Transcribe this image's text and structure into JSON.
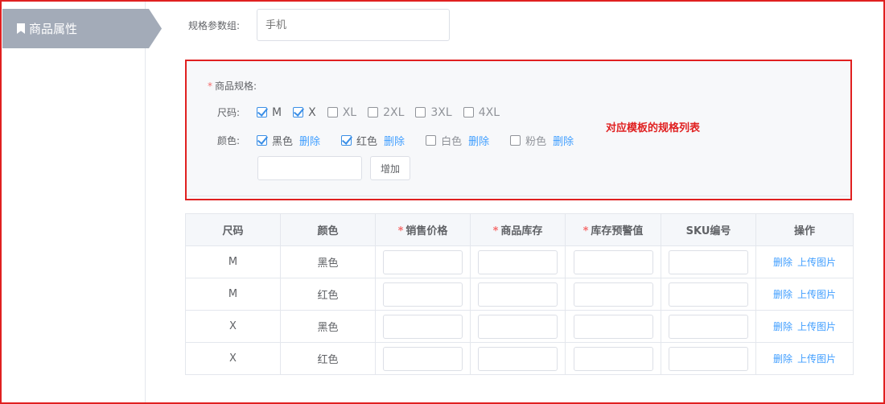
{
  "sidebar": {
    "tab_label": "商品属性",
    "tab_icon": "bookmark-icon"
  },
  "form": {
    "spec_group_label": "规格参数组:",
    "spec_group_placeholder": "手机",
    "spec_title": "商品规格:",
    "size_label": "尺码:",
    "color_label": "颜色:",
    "sizes": [
      {
        "label": "M",
        "checked": true
      },
      {
        "label": "X",
        "checked": true
      },
      {
        "label": "XL",
        "checked": false
      },
      {
        "label": "2XL",
        "checked": false
      },
      {
        "label": "3XL",
        "checked": false
      },
      {
        "label": "4XL",
        "checked": false
      }
    ],
    "colors": [
      {
        "label": "黑色",
        "checked": true,
        "delete": "删除"
      },
      {
        "label": "红色",
        "checked": true,
        "delete": "删除"
      },
      {
        "label": "白色",
        "checked": false,
        "delete": "删除"
      },
      {
        "label": "粉色",
        "checked": false,
        "delete": "删除"
      }
    ],
    "add_button": "增加",
    "add_input_value": ""
  },
  "annotation": "对应模板的规格列表",
  "table": {
    "headers": [
      {
        "label": "尺码",
        "required": false
      },
      {
        "label": "颜色",
        "required": false
      },
      {
        "label": "销售价格",
        "required": true
      },
      {
        "label": "商品库存",
        "required": true
      },
      {
        "label": "库存预警值",
        "required": true
      },
      {
        "label": "SKU编号",
        "required": false
      },
      {
        "label": "操作",
        "required": false
      }
    ],
    "rows": [
      {
        "size": "M",
        "color": "黑色"
      },
      {
        "size": "M",
        "color": "红色"
      },
      {
        "size": "X",
        "color": "黑色"
      },
      {
        "size": "X",
        "color": "红色"
      }
    ],
    "delete_label": "删除",
    "upload_label": "上传图片"
  },
  "colors": {
    "accent": "#409eff",
    "annotation_red": "#e02020",
    "sidebar_tab": "#a3abb8"
  }
}
